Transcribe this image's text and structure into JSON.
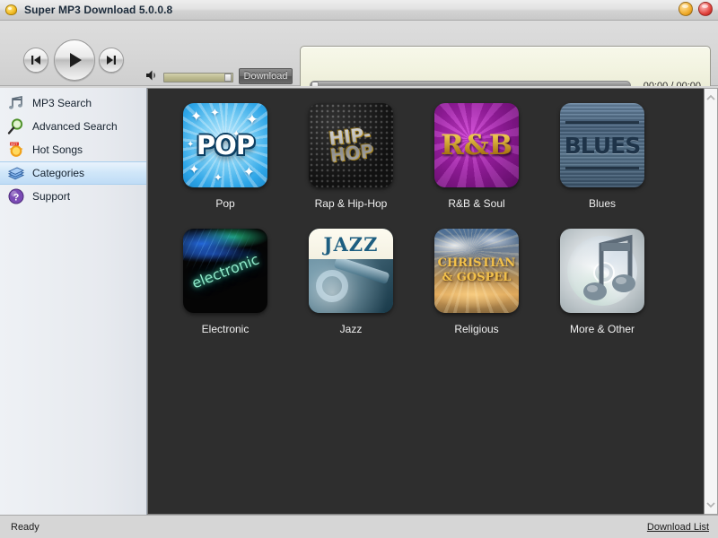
{
  "window": {
    "title": "Super MP3 Download  5.0.0.8",
    "app_icon": "app-logo-icon",
    "controls": [
      {
        "name": "minimize-button",
        "icon": "minimize-circle-icon"
      },
      {
        "name": "close-button",
        "icon": "close-circle-icon"
      }
    ]
  },
  "toolbar": {
    "previous_icon": "skip-previous-icon",
    "play_icon": "play-icon",
    "next_icon": "skip-next-icon",
    "volume_icon": "volume-icon",
    "volume_percent": 88,
    "download_label": "Download"
  },
  "player": {
    "time_label": "00:00 / 00:00",
    "seek_percent": 0
  },
  "sidebar": {
    "items": [
      {
        "label": "MP3 Search",
        "icon": "music-note-icon",
        "selected": false
      },
      {
        "label": "Advanced Search",
        "icon": "magnifier-icon",
        "selected": false
      },
      {
        "label": "Hot Songs",
        "icon": "hot-sun-icon",
        "selected": false
      },
      {
        "label": "Categories",
        "icon": "books-icon",
        "selected": true
      },
      {
        "label": "Support",
        "icon": "question-mark-icon",
        "selected": false
      }
    ]
  },
  "content": {
    "background_color": "#2e2e2e",
    "categories": [
      {
        "label": "Pop",
        "art": "pop",
        "art_text": "POP"
      },
      {
        "label": "Rap & Hip-Hop",
        "art": "hiphop",
        "art_text_line1": "HIP-",
        "art_text_line2": "HOP"
      },
      {
        "label": "R&B & Soul",
        "art": "rnb",
        "art_text": "R&B"
      },
      {
        "label": "Blues",
        "art": "blues",
        "art_text": "BLUES"
      },
      {
        "label": "Electronic",
        "art": "electronic",
        "art_text": "electronic"
      },
      {
        "label": "Jazz",
        "art": "jazz",
        "art_text": "JAZZ"
      },
      {
        "label": "Religious",
        "art": "religious",
        "art_text_line1": "CHRISTIAN",
        "art_text_line2": "& GOSPEL"
      },
      {
        "label": "More & Other",
        "art": "more",
        "art_text": ""
      }
    ]
  },
  "scrollbar": {
    "up_icon": "chevron-up-icon",
    "down_icon": "chevron-down-icon"
  },
  "statusbar": {
    "status": "Ready",
    "download_list_label": "Download List"
  }
}
